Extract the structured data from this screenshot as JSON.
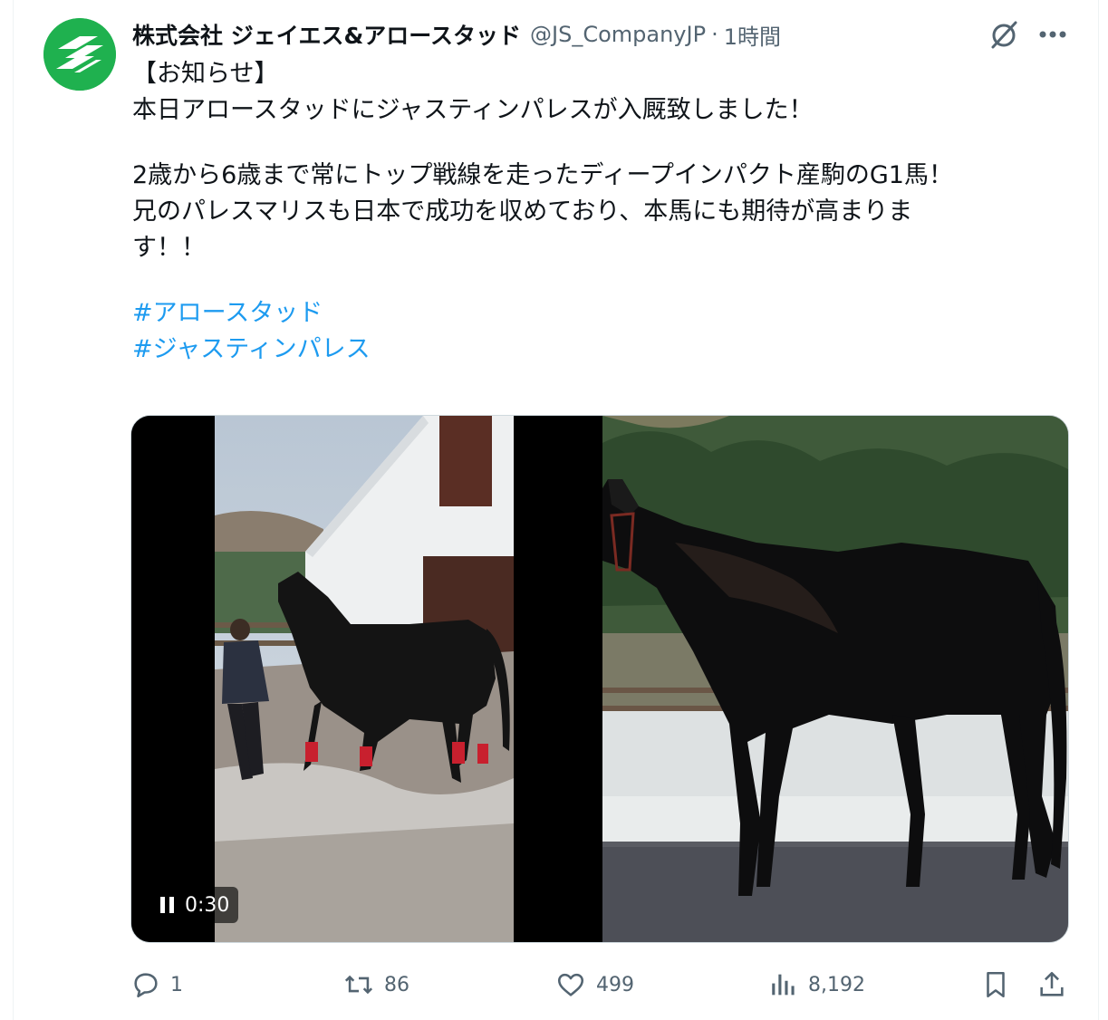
{
  "tweet": {
    "author": {
      "display_name": "株式会社 ジェイエス&アロースタッド",
      "handle": "@JS_CompanyJP",
      "separator": "·",
      "timestamp": "1時間"
    },
    "text_lines": [
      "【お知らせ】",
      "本日アロースタッドにジャスティンパレスが入厩致しました！",
      "2歳から6歳まで常にトップ戦線を走ったディープインパクト産駒のG1馬！",
      "兄のパレスマリスも日本で成功を収めており、本馬にも期待が高まりま",
      "す！！"
    ],
    "hashtags": [
      "#アロースタッド",
      "#ジャスティンパレス"
    ],
    "media": {
      "video_duration": "0:30"
    },
    "metrics": {
      "replies": "1",
      "reposts": "86",
      "likes": "499",
      "views": "8,192"
    }
  },
  "icons": {
    "grok": "grok-icon",
    "more": "more-icon",
    "reply": "reply-icon",
    "repost": "repost-icon",
    "like": "heart-icon",
    "views": "views-icon",
    "bookmark": "bookmark-icon",
    "share": "share-icon",
    "pause": "pause-icon"
  },
  "colors": {
    "text": "#0f1419",
    "secondary": "#536471",
    "link": "#1d9bf0",
    "avatar_bg": "#1fb14f"
  }
}
